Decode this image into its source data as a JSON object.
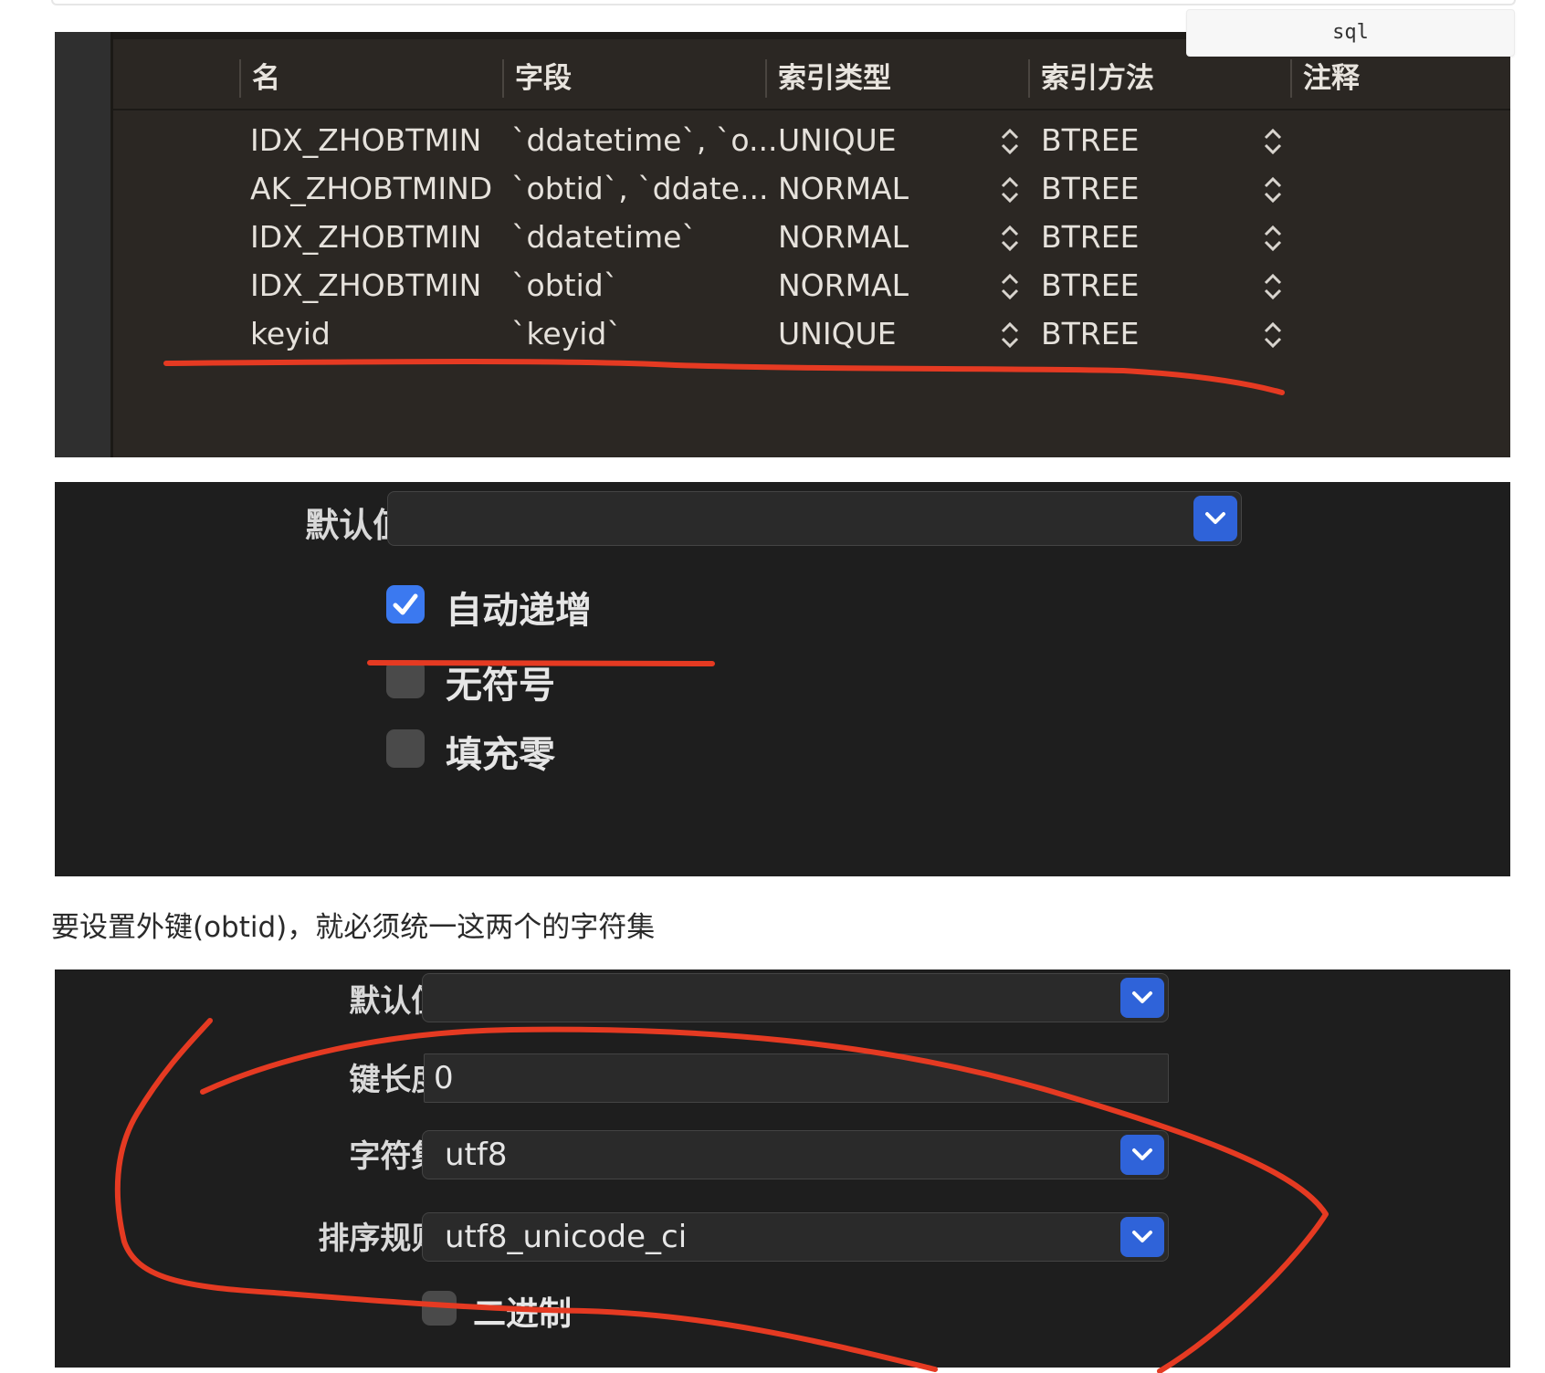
{
  "code_chip": {
    "label": "sql"
  },
  "index_table": {
    "headers": [
      "名",
      "字段",
      "索引类型",
      "索引方法",
      "注释"
    ],
    "rows": [
      {
        "name": "IDX_ZHOBTMIN",
        "field": "`ddatetime`, `o...",
        "type": "UNIQUE",
        "method": "BTREE"
      },
      {
        "name": "AK_ZHOBTMIND",
        "field": "`obtid`, `ddate...",
        "type": "NORMAL",
        "method": "BTREE"
      },
      {
        "name": "IDX_ZHOBTMIN",
        "field": "`ddatetime`",
        "type": "NORMAL",
        "method": "BTREE"
      },
      {
        "name": "IDX_ZHOBTMIN",
        "field": "`obtid`",
        "type": "NORMAL",
        "method": "BTREE"
      },
      {
        "name": "keyid",
        "field": "`keyid`",
        "type": "UNIQUE",
        "method": "BTREE"
      }
    ]
  },
  "field_options": {
    "default_label": "默认值:",
    "default_value": "",
    "checkboxes": [
      {
        "label": "自动递增",
        "checked": true
      },
      {
        "label": "无符号",
        "checked": false
      },
      {
        "label": "填充零",
        "checked": false
      }
    ]
  },
  "caption": "要设置外键(obtid)，就必须统一这两个的字符集",
  "charset_options": {
    "default_label": "默认值:",
    "default_value": "",
    "key_length_label": "键长度:",
    "key_length_value": "0",
    "charset_label": "字符集:",
    "charset_value": "utf8",
    "collation_label": "排序规则:",
    "collation_value": "utf8_unicode_ci",
    "binary_label": "二进制",
    "binary_checked": false
  },
  "colors": {
    "annotation_red": "#e53a22",
    "accent_blue": "#2f63d9",
    "panel_dark": "#1e1e1e",
    "table_bg": "#2b2723"
  }
}
